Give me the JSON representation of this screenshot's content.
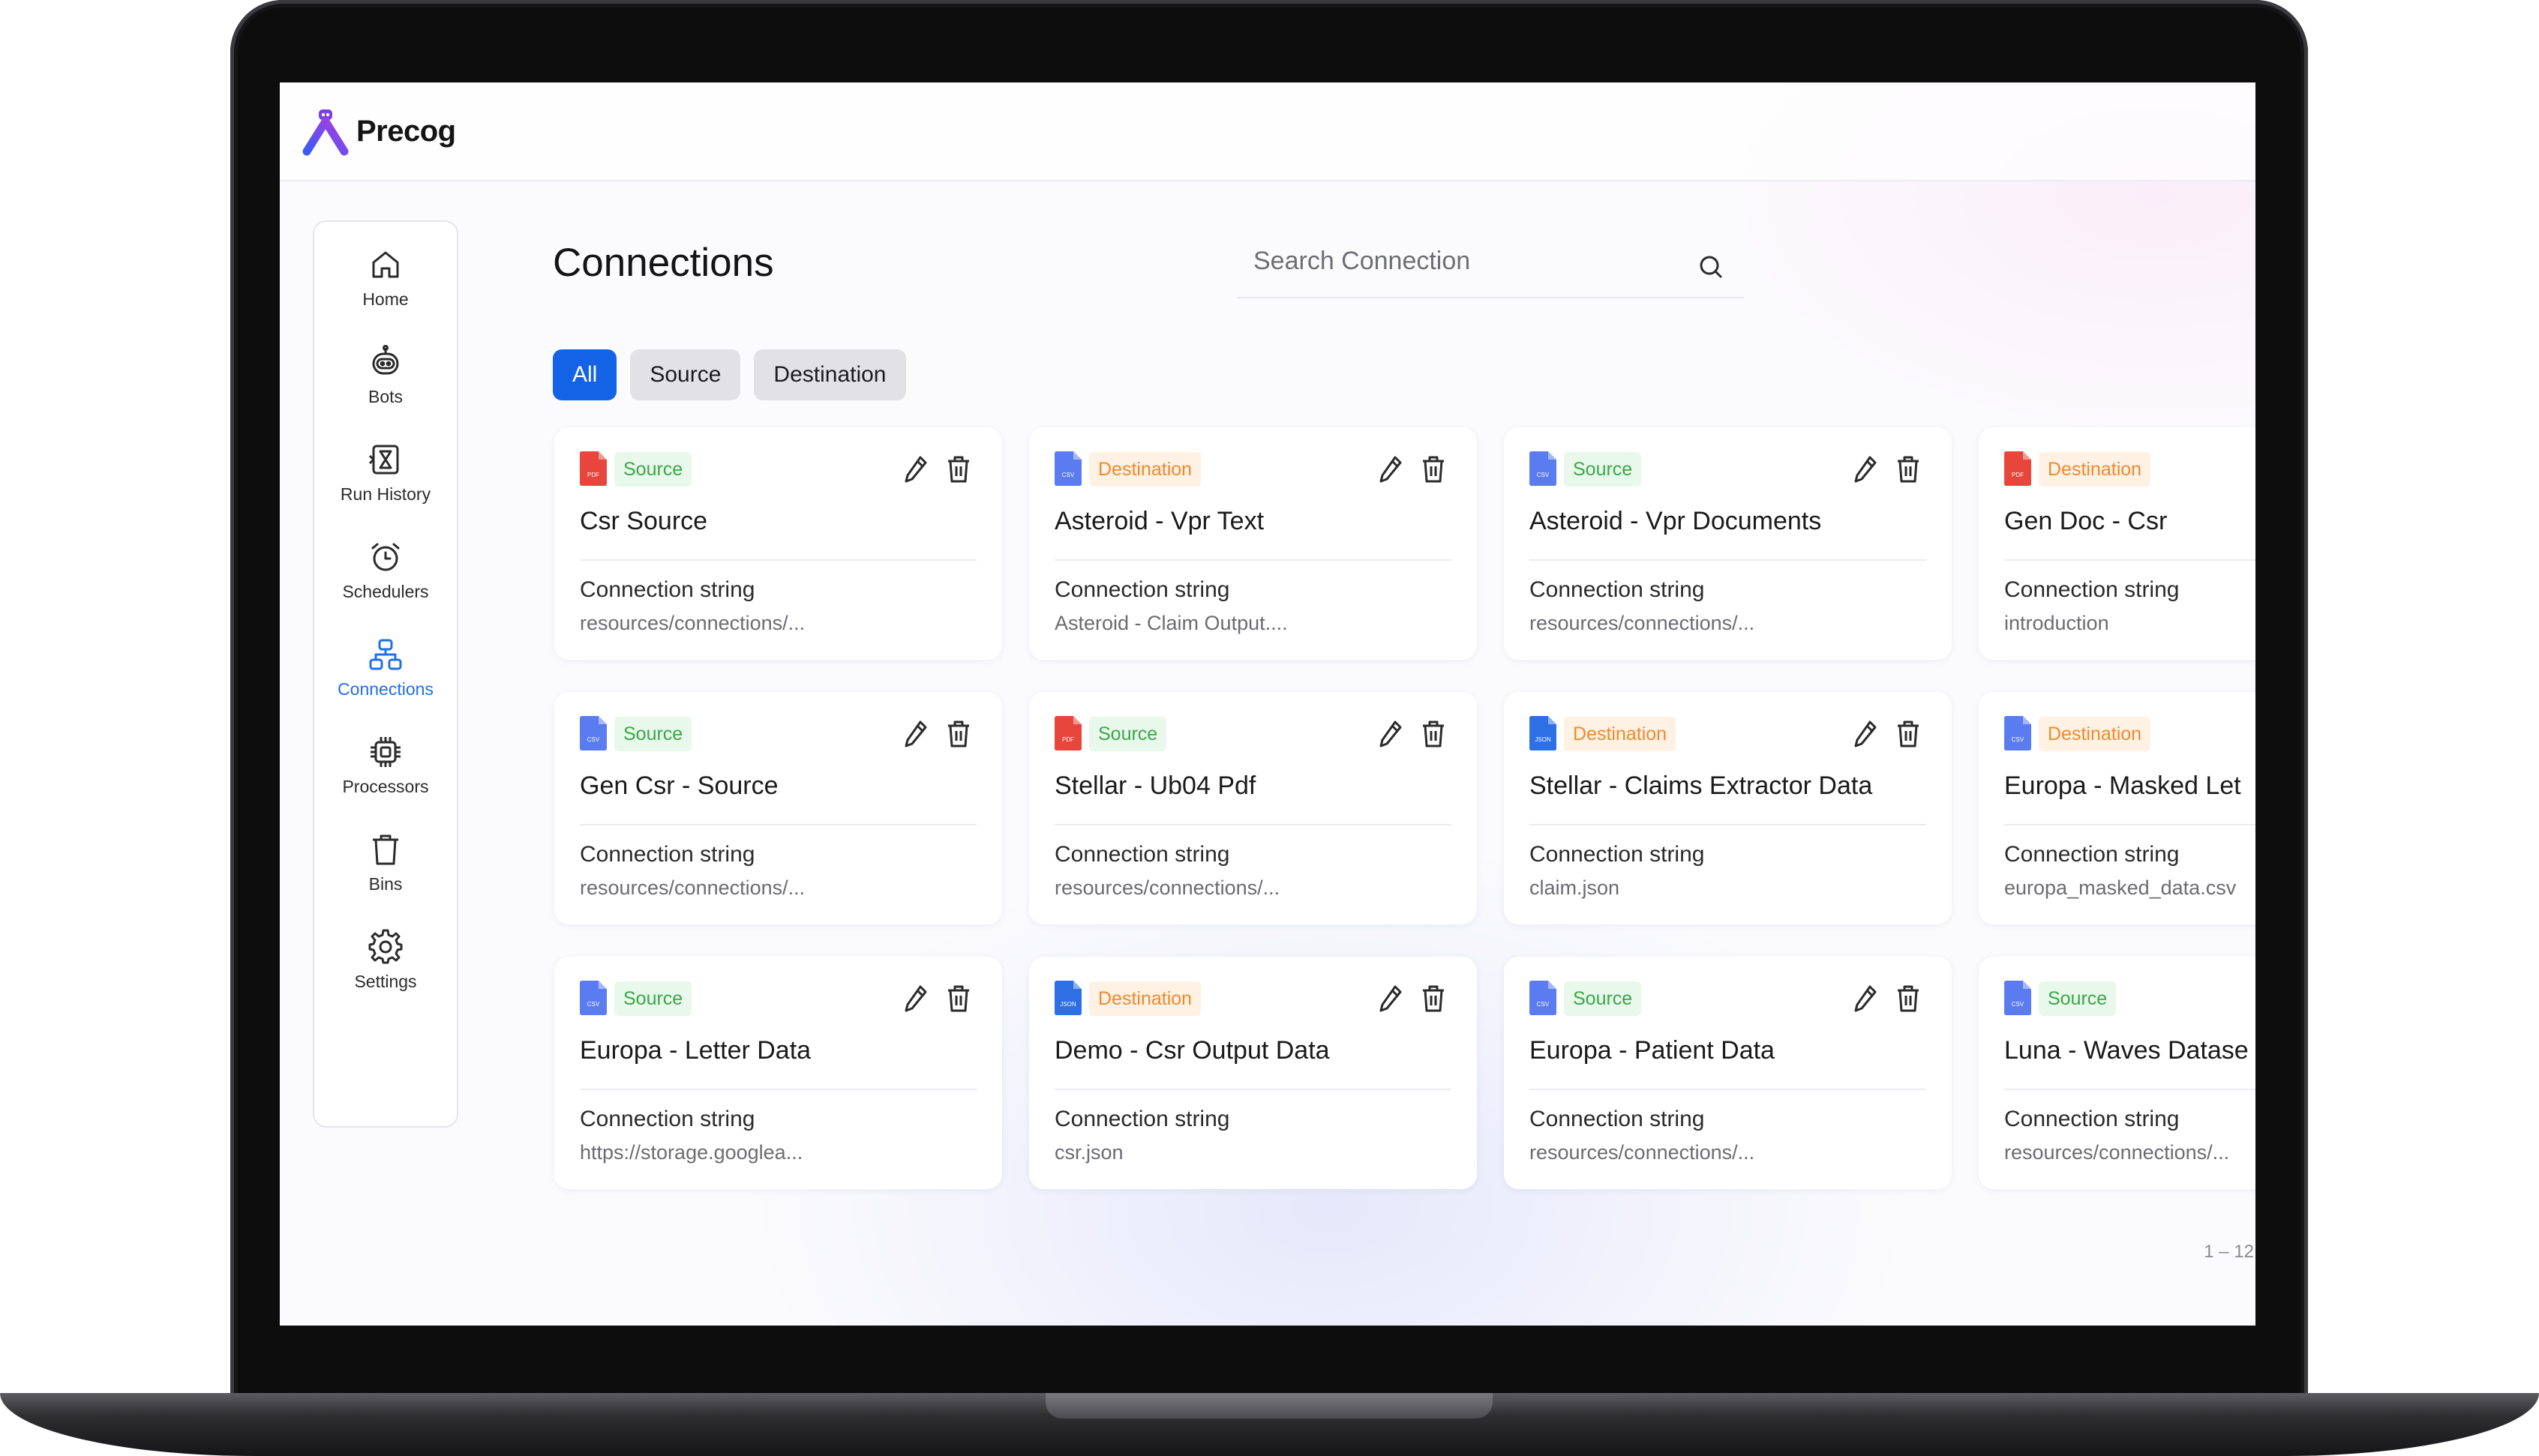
{
  "app": {
    "name": "Precog"
  },
  "sidebar": {
    "items": [
      {
        "label": "Home",
        "icon": "home-icon",
        "active": false
      },
      {
        "label": "Bots",
        "icon": "bot-icon",
        "active": false
      },
      {
        "label": "Run History",
        "icon": "run-history-icon",
        "active": false
      },
      {
        "label": "Schedulers",
        "icon": "alarm-clock-icon",
        "active": false
      },
      {
        "label": "Connections",
        "icon": "connections-icon",
        "active": true
      },
      {
        "label": "Processors",
        "icon": "processor-chip-icon",
        "active": false
      },
      {
        "label": "Bins",
        "icon": "trash-bin-icon",
        "active": false
      },
      {
        "label": "Settings",
        "icon": "gear-icon",
        "active": false
      }
    ]
  },
  "page": {
    "title": "Connections"
  },
  "search": {
    "placeholder": "Search Connection",
    "value": ""
  },
  "filters": [
    {
      "label": "All",
      "active": true
    },
    {
      "label": "Source",
      "active": false
    },
    {
      "label": "Destination",
      "active": false
    }
  ],
  "connection_label": "Connection string",
  "cards": [
    {
      "type": "Source",
      "title": "Csr Source",
      "value": "resources/connections/...",
      "file_icon": "pdf",
      "file_color": "#e8453c"
    },
    {
      "type": "Destination",
      "title": "Asteroid - Vpr Text",
      "value": "Asteroid - Claim Output....",
      "file_icon": "csv",
      "file_color": "#5b7cf0"
    },
    {
      "type": "Source",
      "title": "Asteroid - Vpr Documents",
      "value": "resources/connections/...",
      "file_icon": "csv",
      "file_color": "#5b7cf0"
    },
    {
      "type": "Destination",
      "title": "Gen Doc - Csr",
      "value": "introduction",
      "file_icon": "pdf",
      "file_color": "#e8453c"
    },
    {
      "type": "Source",
      "title": "Gen Csr - Source",
      "value": "resources/connections/...",
      "file_icon": "csv",
      "file_color": "#5b7cf0"
    },
    {
      "type": "Source",
      "title": "Stellar - Ub04 Pdf",
      "value": "resources/connections/...",
      "file_icon": "pdf",
      "file_color": "#e8453c"
    },
    {
      "type": "Destination",
      "title": "Stellar - Claims Extractor Data",
      "value": "claim.json",
      "file_icon": "json",
      "file_color": "#2f6fe4"
    },
    {
      "type": "Destination",
      "title": "Europa - Masked Let",
      "value": "europa_masked_data.csv",
      "file_icon": "csv",
      "file_color": "#5b7cf0"
    },
    {
      "type": "Source",
      "title": "Europa - Letter Data",
      "value": "https://storage.googlea...",
      "file_icon": "csv",
      "file_color": "#5b7cf0"
    },
    {
      "type": "Destination",
      "title": "Demo - Csr Output Data",
      "value": "csr.json",
      "file_icon": "json",
      "file_color": "#2f6fe4"
    },
    {
      "type": "Source",
      "title": "Europa - Patient Data",
      "value": "resources/connections/...",
      "file_icon": "csv",
      "file_color": "#5b7cf0"
    },
    {
      "type": "Source",
      "title": "Luna - Waves Datase",
      "value": "resources/connections/...",
      "file_icon": "csv",
      "file_color": "#5b7cf0"
    }
  ],
  "pagination": {
    "range": "1 – 12"
  },
  "colors": {
    "accent": "#1462e6",
    "source_badge": "#3aa84a",
    "destination_badge": "#f08a2c"
  }
}
